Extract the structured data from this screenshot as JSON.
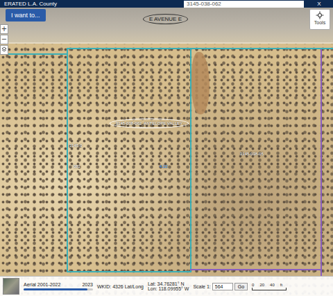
{
  "header": {
    "title": "ERATED L.A. County",
    "search_value": "3145-038-062",
    "close": "X"
  },
  "menu_button": {
    "label": "I want to..."
  },
  "zoom": {
    "in": "+",
    "out": "−"
  },
  "tools": {
    "label": "Tools"
  },
  "map": {
    "street_label": "E AVENUE E",
    "selected_parcel": {
      "number": "3145-038-062",
      "area": "ANTELOPE VALLEY"
    },
    "parcel_labels": [
      {
        "text": "3145-0",
        "color": "#ffffff"
      },
      {
        "text": "082",
        "color": "#ffffff"
      },
      {
        "text": "4.22",
        "color": "#4aa3ff"
      },
      {
        "text": "3145-038-05",
        "color": "#ffffff"
      }
    ]
  },
  "status_bar": {
    "basemap": "Aerial 2001-2022",
    "year": "2023",
    "level": 0.92,
    "wkid": "WKID: 4326 Lat/Long",
    "lat": "Lat: 34.76281° N",
    "lon": "Lon: 118.09955° W",
    "scale_label": "Scale 1:",
    "scale_value": "564",
    "go": "Go",
    "scale_ticks": [
      "0",
      "20",
      "40"
    ],
    "scale_unit": "ft"
  }
}
